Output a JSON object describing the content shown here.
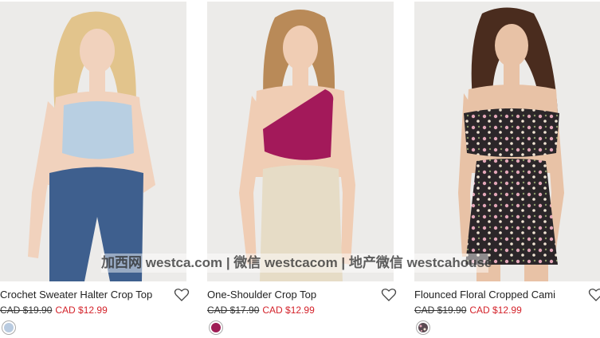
{
  "products": [
    {
      "name": "Crochet Sweater Halter Crop Top",
      "original_price": "CAD $19.90",
      "sale_price": "CAD $12.99",
      "swatch_color": "#b9cbe0",
      "top_color": "#b8cfe2",
      "bottom_color": "#3e5f8e",
      "hair_color": "#e2c48c"
    },
    {
      "name": "One-Shoulder Crop Top",
      "original_price": "CAD $17.90",
      "sale_price": "CAD $12.99",
      "swatch_color": "#9e1d55",
      "top_color": "#a3195a",
      "bottom_color": "#e6dcc6",
      "hair_color": "#b98a58"
    },
    {
      "name": "Flounced Floral Cropped Cami",
      "original_price": "CAD $19.90",
      "sale_price": "CAD $12.99",
      "swatch_color": "#5a4a52",
      "top_color": "#2b2629",
      "bottom_color": "#2b2629",
      "hair_color": "#4a2c1e"
    }
  ],
  "watermark": "加西网 westca.com | 微信 westcacom | 地产微信 westcahouse",
  "colors": {
    "sale": "#d4232b",
    "background": "#ffffff",
    "photo_background": "#ecebe9"
  },
  "icons": {
    "wishlist": "heart-outline-icon"
  }
}
